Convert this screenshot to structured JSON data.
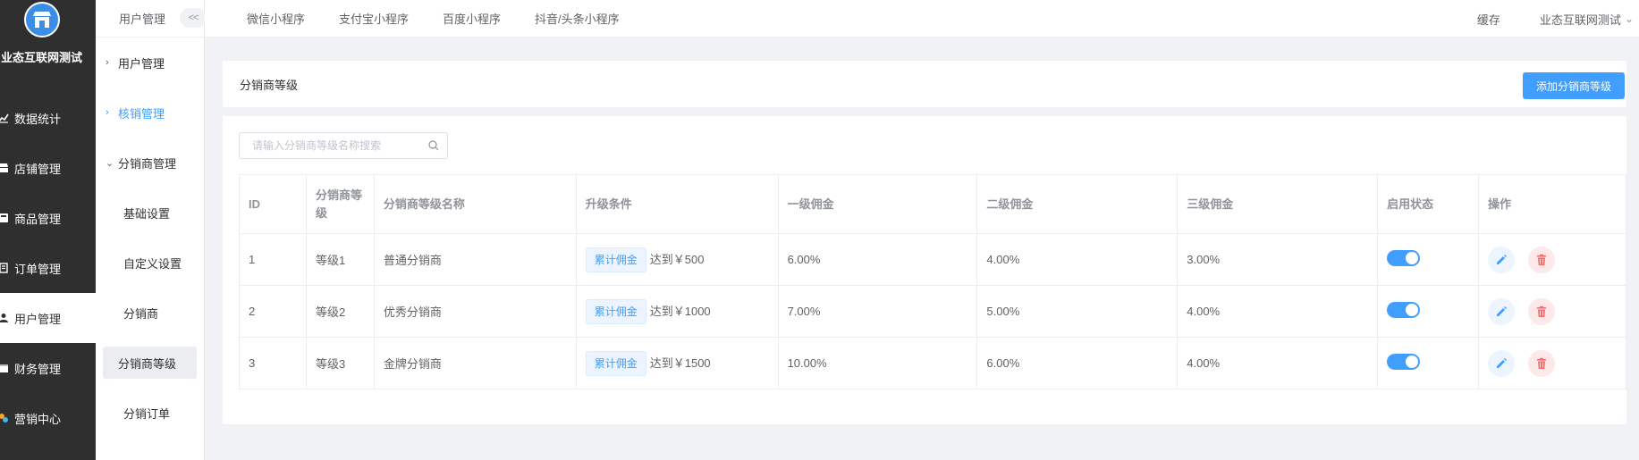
{
  "sidebar": {
    "store_name": "业态互联网测试",
    "items": [
      {
        "label": "数据统计",
        "icon": "chart-line-icon"
      },
      {
        "label": "店铺管理",
        "icon": "store-icon"
      },
      {
        "label": "商品管理",
        "icon": "goods-icon"
      },
      {
        "label": "订单管理",
        "icon": "order-icon"
      },
      {
        "label": "用户管理",
        "icon": "user-icon",
        "active": true
      },
      {
        "label": "财务管理",
        "icon": "finance-icon"
      },
      {
        "label": "营销中心",
        "icon": "marketing-icon"
      }
    ]
  },
  "subbar": {
    "header": "用户管理",
    "collapse_label": "<<",
    "groups": [
      {
        "label": "用户管理",
        "expanded": false
      },
      {
        "label": "核销管理",
        "expanded": false
      },
      {
        "label": "分销商管理",
        "expanded": true
      }
    ],
    "children": [
      "基础设置",
      "自定义设置",
      "分销商",
      "分销商等级",
      "分销订单"
    ],
    "selected_child": "分销商等级"
  },
  "topbar": {
    "tabs": [
      "微信小程序",
      "支付宝小程序",
      "百度小程序",
      "抖音/头条小程序"
    ],
    "cache": "缓存",
    "account": "业态互联网测试"
  },
  "page": {
    "title": "分销商等级",
    "add_button": "添加分销商等级",
    "search_placeholder": "请输入分销商等级名称搜索"
  },
  "table": {
    "headers": [
      "ID",
      "分销商等级",
      "分销商等级名称",
      "升级条件",
      "一级佣金",
      "二级佣金",
      "三级佣金",
      "启用状态",
      "操作"
    ],
    "rows": [
      {
        "id": "1",
        "level": "等级1",
        "name": "普通分销商",
        "cond_tag": "累计佣金",
        "cond_text": "达到￥500",
        "c1": "6.00%",
        "c2": "4.00%",
        "c3": "3.00%",
        "enabled": true
      },
      {
        "id": "2",
        "level": "等级2",
        "name": "优秀分销商",
        "cond_tag": "累计佣金",
        "cond_text": "达到￥1000",
        "c1": "7.00%",
        "c2": "5.00%",
        "c3": "4.00%",
        "enabled": true
      },
      {
        "id": "3",
        "level": "等级3",
        "name": "金牌分销商",
        "cond_tag": "累计佣金",
        "cond_text": "达到￥1500",
        "c1": "10.00%",
        "c2": "6.00%",
        "c3": "4.00%",
        "enabled": true
      }
    ]
  },
  "colors": {
    "primary": "#409eff",
    "danger": "#f56c6c",
    "sidebar_bg": "#2f2f2f"
  }
}
